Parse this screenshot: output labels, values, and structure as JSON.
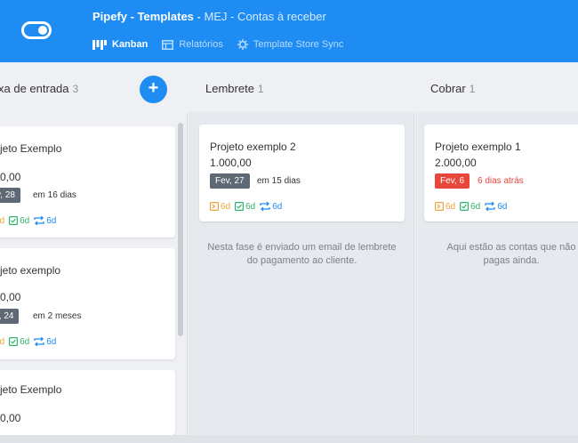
{
  "header": {
    "app": "Pipefy - Templates",
    "separator": "-",
    "subtitle": "MEJ - Contas à receber",
    "nav": [
      {
        "label": "Kanban",
        "icon": "kanban-icon"
      },
      {
        "label": "Relatórios",
        "icon": "report-icon"
      },
      {
        "label": "Template Store Sync",
        "icon": "sync-gear-icon"
      }
    ]
  },
  "columns": [
    {
      "title": "xa de entrada",
      "count": "3",
      "cards": [
        {
          "name": "jeto Exemplo",
          "value": "0,00",
          "date": "v, 28",
          "due": "em 16 dias",
          "tags": [
            "6d",
            "6d",
            "6d"
          ]
        },
        {
          "name": "jeto exemplo",
          "value": "0,00",
          "date": "r, 24",
          "due": "em 2 meses",
          "tags": [
            "6d",
            "6d",
            "6d"
          ]
        },
        {
          "name": "jeto Exemplo",
          "value": "0,00"
        }
      ]
    },
    {
      "title": "Lembrete",
      "count": "1",
      "cards": [
        {
          "name": "Projeto exemplo 2",
          "value": "1.000,00",
          "date": "Fev, 27",
          "due": "em 15 dias",
          "tags": [
            "6d",
            "6d",
            "6d"
          ]
        }
      ],
      "description": "Nesta fase é enviado um email de lembrete do pagamento ao cliente."
    },
    {
      "title": "Cobrar",
      "count": "1",
      "cards": [
        {
          "name": "Projeto exemplo 1",
          "value": "2.000,00",
          "date": "Fev, 6",
          "due": "6 dias atrás",
          "tags": [
            "6d",
            "6d",
            "6d"
          ]
        }
      ],
      "description": "Aqui estão as contas que não pagas ainda."
    }
  ],
  "add_button": "+",
  "colors": {
    "brand": "#1e8cf2",
    "overdue": "#e8463a",
    "badge": "#5f6975"
  }
}
